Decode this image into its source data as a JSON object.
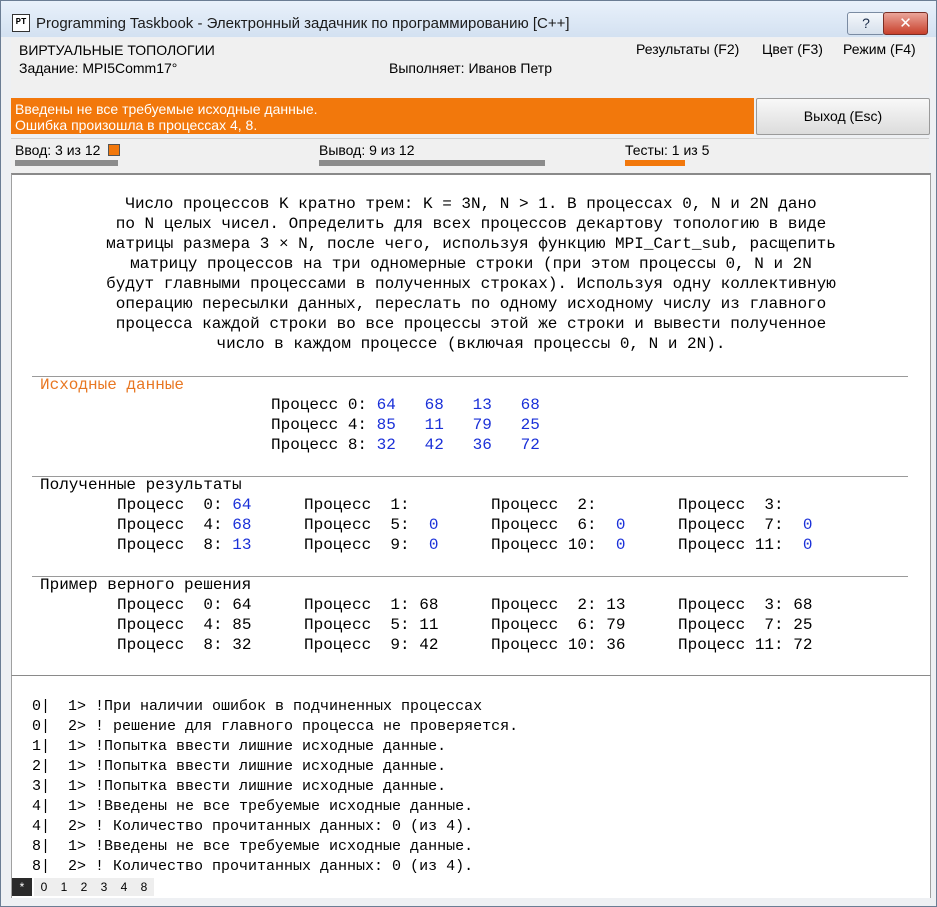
{
  "window": {
    "title": "Programming Taskbook - Электронный задачник по программированию [C++]",
    "app_icon_text": "PT",
    "help_label": "?",
    "close_label": "✕"
  },
  "header": {
    "topic": "ВИРТУАЛЬНЫЕ ТОПОЛОГИИ",
    "task": "Задание: MPI5Comm17°",
    "performer": "Выполняет: Иванов Петр",
    "menu": [
      "Результаты (F2)",
      "Цвет (F3)",
      "Режим (F4)"
    ]
  },
  "status": {
    "error_line1": "Введены не все требуемые исходные данные.",
    "error_line2": "Ошибка произошла в процессах 4, 8.",
    "exit_label": "Выход (Esc)"
  },
  "counters": {
    "input": "Ввод: 3 из 12",
    "output": "Вывод: 9 из 12",
    "tests": "Тесты: 1 из 5",
    "colors": {
      "bar_gray": "#8c8c8c",
      "bar_orange": "#f2780c"
    }
  },
  "task": {
    "description": [
      "Число процессов K кратно трем: K = 3N, N > 1. В процессах 0, N и 2N дано",
      "по N целых чисел. Определить для всех процессов декартову топологию в виде",
      "матрицы размера 3 × N, после чего, используя функцию MPI_Cart_sub, расщепить",
      "матрицу процессов на три одномерные строки (при этом процессы 0, N и 2N",
      "будут главными процессами в полученных строках). Используя одну коллективную",
      "операцию пересылки данных, переслать по одному исходному числу из главного",
      "процесса каждой строки во все процессы этой же строки и вывести полученное",
      "число в каждом процессе (включая процессы 0, N и 2N)."
    ],
    "input_title": "Исходные данные",
    "input_rows": [
      {
        "label": "Процесс 0:",
        "values": "64   68   13   68"
      },
      {
        "label": "Процесс 4:",
        "values": "85   11   79   25"
      },
      {
        "label": "Процесс 8:",
        "values": "32   42   36   72"
      }
    ],
    "results_title": "Полученные результаты",
    "results_rows": [
      [
        {
          "label": "Процесс  0:",
          "value": "64"
        },
        {
          "label": "Процесс  1:",
          "value": ""
        },
        {
          "label": "Процесс  2:",
          "value": ""
        },
        {
          "label": "Процесс  3:",
          "value": ""
        }
      ],
      [
        {
          "label": "Процесс  4:",
          "value": "68"
        },
        {
          "label": "Процесс  5:",
          "value": "0"
        },
        {
          "label": "Процесс  6:",
          "value": "0"
        },
        {
          "label": "Процесс  7:",
          "value": "0"
        }
      ],
      [
        {
          "label": "Процесс  8:",
          "value": "13"
        },
        {
          "label": "Процесс  9:",
          "value": "0"
        },
        {
          "label": "Процесс 10:",
          "value": "0"
        },
        {
          "label": "Процесс 11:",
          "value": "0"
        }
      ]
    ],
    "example_title": "Пример верного решения",
    "example_rows": [
      [
        "Процесс  0: 64",
        "Процесс  1: 68",
        "Процесс  2: 13",
        "Процесс  3: 68"
      ],
      [
        "Процесс  4: 85",
        "Процесс  5: 11",
        "Процесс  6: 79",
        "Процесс  7: 25"
      ],
      [
        "Процесс  8: 32",
        "Процесс  9: 42",
        "Процесс 10: 36",
        "Процесс 11: 72"
      ]
    ]
  },
  "debug": {
    "lines": [
      "0|  1> !При наличии ошибок в подчиненных процессах",
      "0|  2> ! решение для главного процесса не проверяется.",
      "1|  1> !Попытка ввести лишние исходные данные.",
      "2|  1> !Попытка ввести лишние исходные данные.",
      "3|  1> !Попытка ввести лишние исходные данные.",
      "4|  1> !Введены не все требуемые исходные данные.",
      "4|  2> ! Количество прочитанных данных: 0 (из 4).",
      "8|  1> !Введены не все требуемые исходные данные.",
      "8|  2> ! Количество прочитанных данных: 0 (из 4)."
    ],
    "tabs": [
      "*",
      "0",
      "1",
      "2",
      "3",
      "4",
      "8"
    ]
  }
}
